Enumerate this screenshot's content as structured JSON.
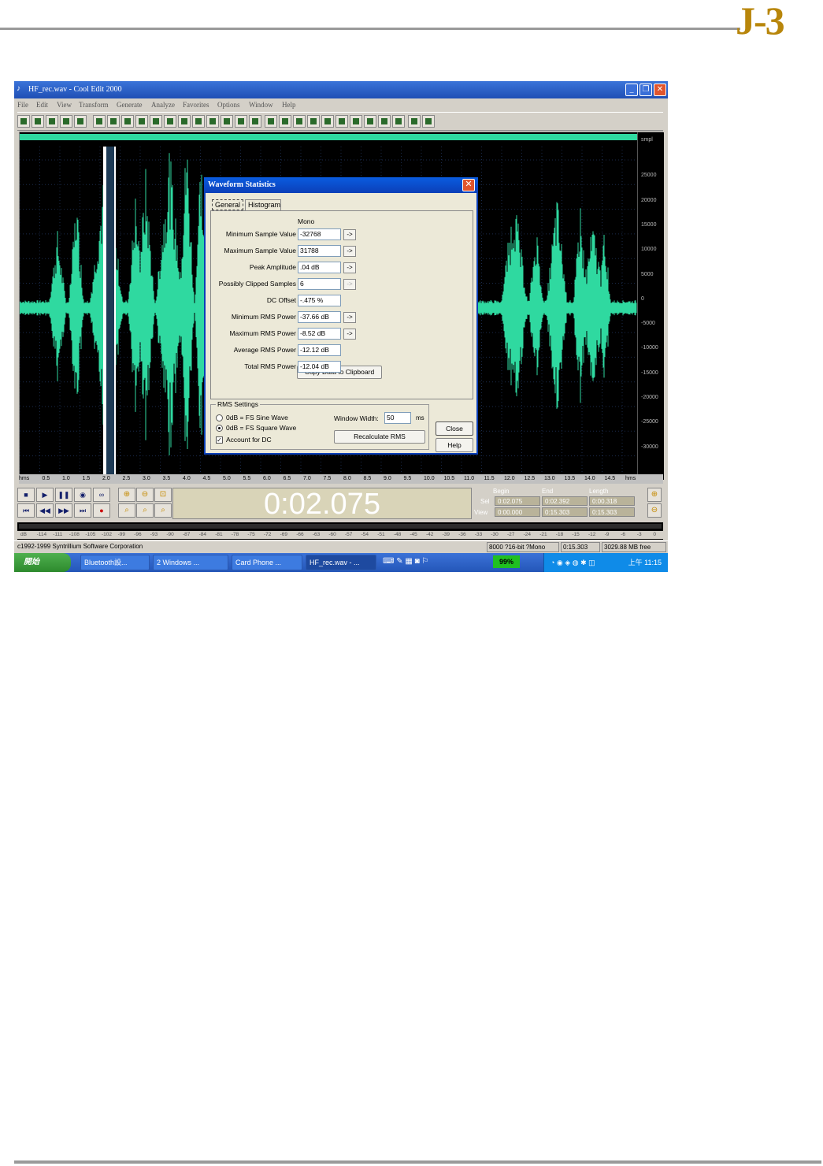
{
  "header": {
    "logo": "J-3"
  },
  "window": {
    "title": "HF_rec.wav - Cool Edit 2000",
    "menu": [
      "File",
      "Edit",
      "View",
      "Transform",
      "Generate",
      "Analyze",
      "Favorites",
      "Options",
      "Window",
      "Help"
    ]
  },
  "right_scale": [
    "smpl",
    "25000",
    "20000",
    "15000",
    "10000",
    "5000",
    "0",
    "-5000",
    "-10000",
    "-15000",
    "-20000",
    "-25000",
    "-30000"
  ],
  "timeline": [
    "hms",
    "0.5",
    "1.0",
    "1.5",
    "2.0",
    "2.5",
    "3.0",
    "3.5",
    "4.0",
    "4.5",
    "5.0",
    "5.5",
    "6.0",
    "6.5",
    "7.0",
    "7.5",
    "8.0",
    "8.5",
    "9.0",
    "9.5",
    "10.0",
    "10.5",
    "11.0",
    "11.5",
    "12.0",
    "12.5",
    "13.0",
    "13.5",
    "14.0",
    "14.5",
    "hms"
  ],
  "transport": {
    "clock": "0:02.075",
    "headers": {
      "begin": "Begin",
      "end": "End",
      "length": "Length"
    },
    "sel": {
      "label": "Sel",
      "begin": "0:02.075",
      "end": "0:02.392",
      "length": "0:00.318"
    },
    "view": {
      "label": "View",
      "begin": "0:00.000",
      "end": "0:15.303",
      "length": "0:15.303"
    }
  },
  "vu_scale": [
    "dB",
    "-114",
    "-111",
    "-108",
    "-105",
    "-102",
    "-99",
    "-96",
    "-93",
    "-90",
    "-87",
    "-84",
    "-81",
    "-78",
    "-75",
    "-72",
    "-69",
    "-66",
    "-63",
    "-60",
    "-57",
    "-54",
    "-51",
    "-48",
    "-45",
    "-42",
    "-39",
    "-36",
    "-33",
    "-30",
    "-27",
    "-24",
    "-21",
    "-18",
    "-15",
    "-12",
    "-9",
    "-6",
    "-3",
    "0"
  ],
  "status": {
    "copyright": "c1992-1999 Syntrillium Software Corporation",
    "format": "8000 ?16-bit ?Mono",
    "duration": "0:15.303",
    "free": "3029.88 MB free"
  },
  "taskbar": {
    "start": "開始",
    "tasks": [
      "Bluetooth設...",
      "2 Windows ...",
      "Card Phone ...",
      "HF_rec.wav - ..."
    ],
    "battery": "99%",
    "clock": "上午 11:15"
  },
  "dialog": {
    "title": "Waveform Statistics",
    "tabs": [
      "General",
      "Histogram"
    ],
    "channel": "Mono",
    "rows": [
      {
        "label": "Minimum Sample Value",
        "value": "-32768",
        "btn": "->",
        "enabled": true
      },
      {
        "label": "Maximum Sample Value",
        "value": "31788",
        "btn": "->",
        "enabled": true
      },
      {
        "label": "Peak Amplitude",
        "value": ".04 dB",
        "btn": "->",
        "enabled": true
      },
      {
        "label": "Possibly Clipped Samples",
        "value": "6",
        "btn": "->",
        "enabled": false
      },
      {
        "label": "DC Offset",
        "value": "-.475 %",
        "btn": "",
        "enabled": false
      },
      {
        "label": "Minimum RMS Power",
        "value": "-37.66 dB",
        "btn": "->",
        "enabled": true
      },
      {
        "label": "Maximum RMS Power",
        "value": "-8.52 dB",
        "btn": "->",
        "enabled": true
      },
      {
        "label": "Average RMS Power",
        "value": "-12.12 dB",
        "btn": "",
        "enabled": false
      },
      {
        "label": "Total RMS Power",
        "value": "-12.04 dB",
        "btn": "",
        "enabled": false
      }
    ],
    "copy_button": "Copy Data to Clipboard",
    "rms": {
      "legend": "RMS Settings",
      "sine": "0dB = FS Sine Wave",
      "square": "0dB = FS Square Wave",
      "dc": "Account for DC",
      "window_width_label": "Window Width:",
      "window_width": "50",
      "unit": "ms",
      "recalc": "Recalculate RMS"
    },
    "close": "Close",
    "help": "Help"
  }
}
